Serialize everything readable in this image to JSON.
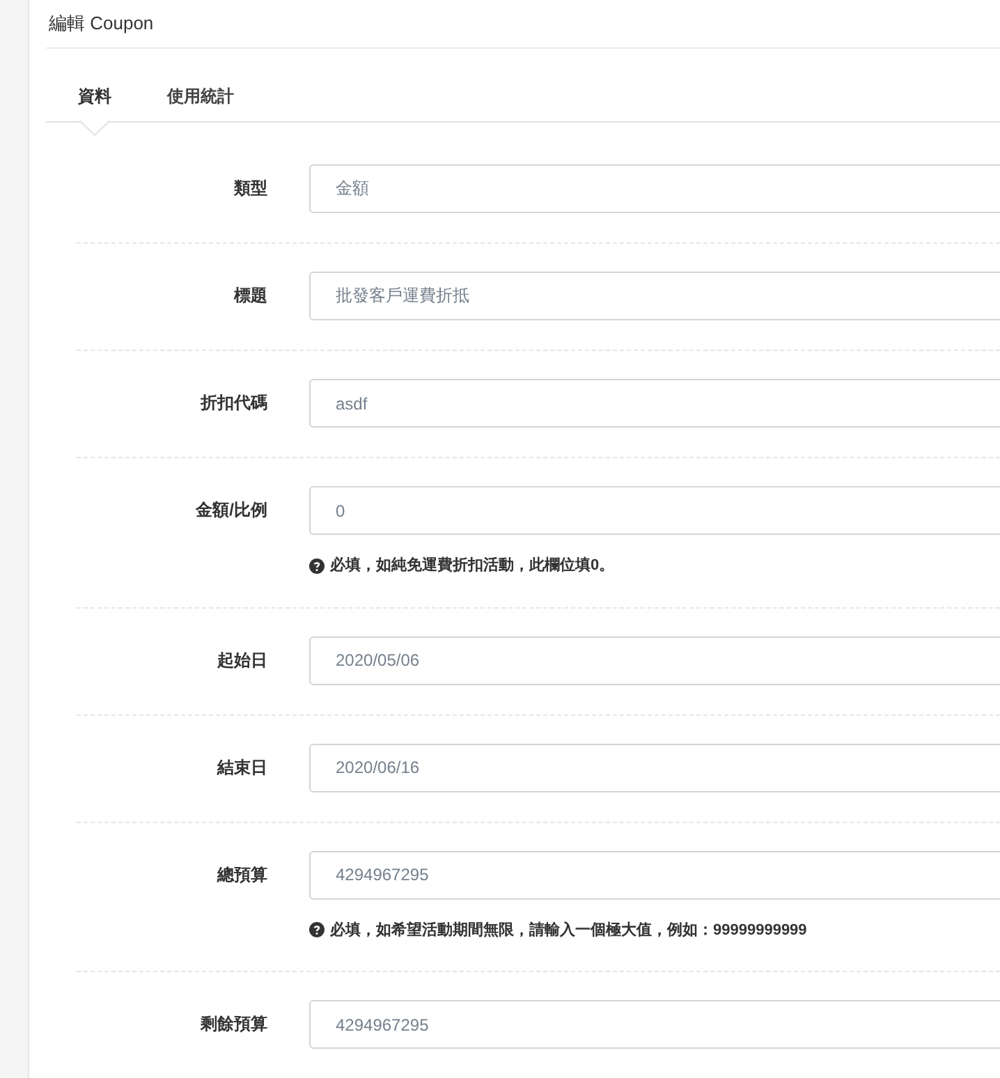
{
  "page_title": "編輯 Coupon",
  "tabs": [
    {
      "label": "資料",
      "selected": true
    },
    {
      "label": "使用統計",
      "selected": false
    }
  ],
  "fields": [
    {
      "label": "類型",
      "value": "金額"
    },
    {
      "label": "標題",
      "value": "批發客戶運費折抵"
    },
    {
      "label": "折扣代碼",
      "value": "asdf"
    },
    {
      "label": "金額/比例",
      "value": "0",
      "hint": "必填，如純免運費折扣活動，此欄位填0。"
    },
    {
      "label": "起始日",
      "value": "2020/05/06"
    },
    {
      "label": "結束日",
      "value": "2020/06/16"
    },
    {
      "label": "總預算",
      "value": "4294967295",
      "hint": "必填，如希望活動期間無限，請輸入一個極大值，例如：99999999999"
    },
    {
      "label": "剩餘預算",
      "value": "4294967295"
    }
  ]
}
